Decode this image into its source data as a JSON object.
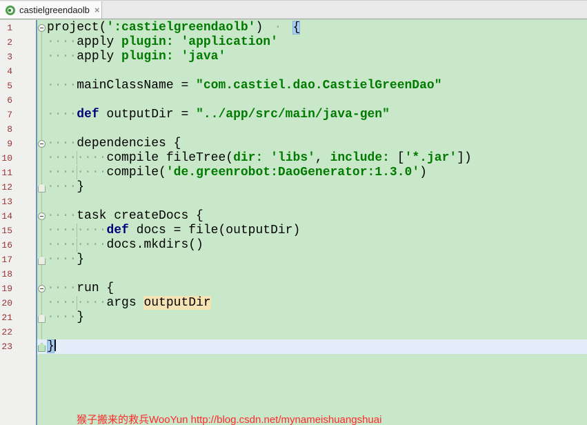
{
  "tab": {
    "title": "castielgreendaolb",
    "close_glyph": "×",
    "icon": "gradle-file-icon"
  },
  "colors": {
    "editor_background": "#c9e8c9",
    "gutter_background": "#f0f0ee",
    "gutter_border_blue": "#6e93bb",
    "line_number": "#993333",
    "string_keyword_green": "#007a00",
    "def_keyword_navy": "#00007a",
    "bracket_match_blue": "#a8cdf0",
    "current_line_blue": "#e4eefa",
    "occurrence_wheat": "#f6e3b4",
    "watermark_red": "#ff2a2a"
  },
  "editor": {
    "language": "gradle-groovy",
    "lines": [
      {
        "num": 1,
        "fold": "open",
        "tokens": [
          [
            "p",
            "project("
          ],
          [
            "s",
            "':castielgreendaolb'"
          ],
          [
            "p",
            ")"
          ],
          [
            "g",
            "·"
          ],
          [
            "b",
            "{"
          ]
        ]
      },
      {
        "num": 2,
        "indent": 4,
        "tokens": [
          [
            "p",
            "apply "
          ],
          [
            "s",
            "plugin:"
          ],
          [
            "p",
            " "
          ],
          [
            "s",
            "'application'"
          ]
        ]
      },
      {
        "num": 3,
        "indent": 4,
        "tokens": [
          [
            "p",
            "apply "
          ],
          [
            "s",
            "plugin:"
          ],
          [
            "p",
            " "
          ],
          [
            "s",
            "'java'"
          ]
        ]
      },
      {
        "num": 4
      },
      {
        "num": 5,
        "indent": 4,
        "tokens": [
          [
            "p",
            "mainClassName = "
          ],
          [
            "s",
            "\"com.castiel.dao.CastielGreenDao\""
          ]
        ]
      },
      {
        "num": 6
      },
      {
        "num": 7,
        "indent": 4,
        "tokens": [
          [
            "k",
            "def"
          ],
          [
            "p",
            " outputDir = "
          ],
          [
            "s",
            "\"../app/src/main/java-gen\""
          ]
        ]
      },
      {
        "num": 8
      },
      {
        "num": 9,
        "fold": "open",
        "indent": 4,
        "tokens": [
          [
            "p",
            "dependencies {"
          ]
        ]
      },
      {
        "num": 10,
        "indent": 8,
        "tokens": [
          [
            "p",
            "compile fileTree("
          ],
          [
            "s",
            "dir:"
          ],
          [
            "p",
            " "
          ],
          [
            "s",
            "'libs'"
          ],
          [
            "p",
            ", "
          ],
          [
            "s",
            "include:"
          ],
          [
            "p",
            " ["
          ],
          [
            "s",
            "'*.jar'"
          ],
          [
            "p",
            "])"
          ]
        ]
      },
      {
        "num": 11,
        "indent": 8,
        "tokens": [
          [
            "p",
            "compile("
          ],
          [
            "s",
            "'de.greenrobot:DaoGenerator:1.3.0'"
          ],
          [
            "p",
            ")"
          ]
        ]
      },
      {
        "num": 12,
        "fold": "end",
        "indent": 4,
        "tokens": [
          [
            "p",
            "}"
          ]
        ]
      },
      {
        "num": 13
      },
      {
        "num": 14,
        "fold": "open",
        "indent": 4,
        "tokens": [
          [
            "p",
            "task createDocs {"
          ]
        ]
      },
      {
        "num": 15,
        "indent": 8,
        "tokens": [
          [
            "k",
            "def"
          ],
          [
            "p",
            " docs = file(outputDir)"
          ]
        ]
      },
      {
        "num": 16,
        "indent": 8,
        "tokens": [
          [
            "p",
            "docs.mkdirs()"
          ]
        ]
      },
      {
        "num": 17,
        "fold": "end",
        "indent": 4,
        "tokens": [
          [
            "p",
            "}"
          ]
        ]
      },
      {
        "num": 18
      },
      {
        "num": 19,
        "fold": "open",
        "indent": 4,
        "tokens": [
          [
            "p",
            "run {"
          ]
        ]
      },
      {
        "num": 20,
        "indent": 8,
        "tokens": [
          [
            "p",
            "args "
          ],
          [
            "o",
            "outputDir"
          ]
        ]
      },
      {
        "num": 21,
        "fold": "end",
        "indent": 4,
        "tokens": [
          [
            "p",
            "}"
          ]
        ]
      },
      {
        "num": 22
      },
      {
        "num": 23,
        "fold": "end2",
        "current": true,
        "cursor": true,
        "tokens": [
          [
            "b",
            "}"
          ]
        ]
      }
    ]
  },
  "watermark": {
    "text": "猴子搬来的救兵WooYun http://blog.csdn.net/mynameishuangshuai"
  }
}
